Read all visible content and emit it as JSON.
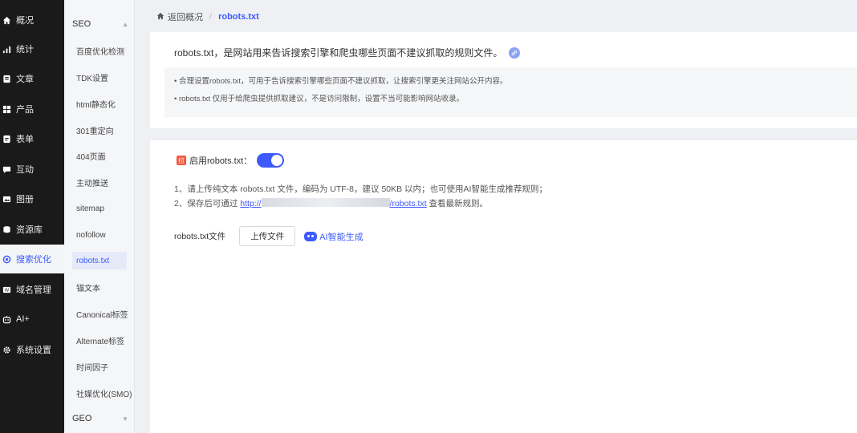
{
  "nav": [
    {
      "icon": "home-icon",
      "label": "概况"
    },
    {
      "icon": "stats-icon",
      "label": "统计"
    },
    {
      "icon": "article-icon",
      "label": "文章"
    },
    {
      "icon": "product-icon",
      "label": "产品"
    },
    {
      "icon": "form-icon",
      "label": "表单"
    },
    {
      "icon": "chat-icon",
      "label": "互动"
    },
    {
      "icon": "image-icon",
      "label": "图册"
    },
    {
      "icon": "database-icon",
      "label": "资源库"
    },
    {
      "icon": "seo-icon",
      "label": "搜索优化"
    },
    {
      "icon": "domain-icon",
      "label": "域名管理"
    },
    {
      "icon": "ai-icon",
      "label": "AI+"
    },
    {
      "icon": "gear-icon",
      "label": "系统设置"
    }
  ],
  "submenu": {
    "seo_head": "SEO",
    "geo_head": "GEO",
    "items": [
      "百度优化检测",
      "TDK设置",
      "html静态化",
      "301重定向",
      "404页面",
      "主动推送",
      "sitemap",
      "nofollow",
      "robots.txt",
      "锚文本",
      "Canonical标签",
      "Alternate标签",
      "时间因子",
      "社媒优化(SMO)"
    ]
  },
  "breadcrumb": {
    "back": "返回概况",
    "separator": "/",
    "current": "robots.txt"
  },
  "intro": {
    "text": "robots.txt，是网站用来告诉搜索引擎和爬虫哪些页面不建议抓取的规则文件。",
    "tips": [
      "• 合理设置robots.txt，可用于告诉搜索引擎哪些页面不建议抓取，让搜索引擎更关注网站公开内容。",
      "• robots.txt 仅用于给爬虫提供抓取建议，不是访问限制，设置不当可能影响网站收录。"
    ]
  },
  "settings": {
    "badge": "拉",
    "enable_label": "启用robots.txt：",
    "enabled": true,
    "note1": "1、请上传纯文本 robots.txt 文件，编码为 UTF-8，建议 50KB 以内；也可使用AI智能生成推荐规则；",
    "note2_prefix": "2、保存后可通过 ",
    "note2_url_start": "http://",
    "note2_url_end": "/robots.txt",
    "note2_suffix": " 查看最新规则。",
    "file_label": "robots.txt文件",
    "upload_label": "上传文件",
    "ai_label": "AI智能生成"
  },
  "colors": {
    "accent": "#3d5afe",
    "sidebar": "#1a1a1a",
    "badge": "#f2573f"
  }
}
